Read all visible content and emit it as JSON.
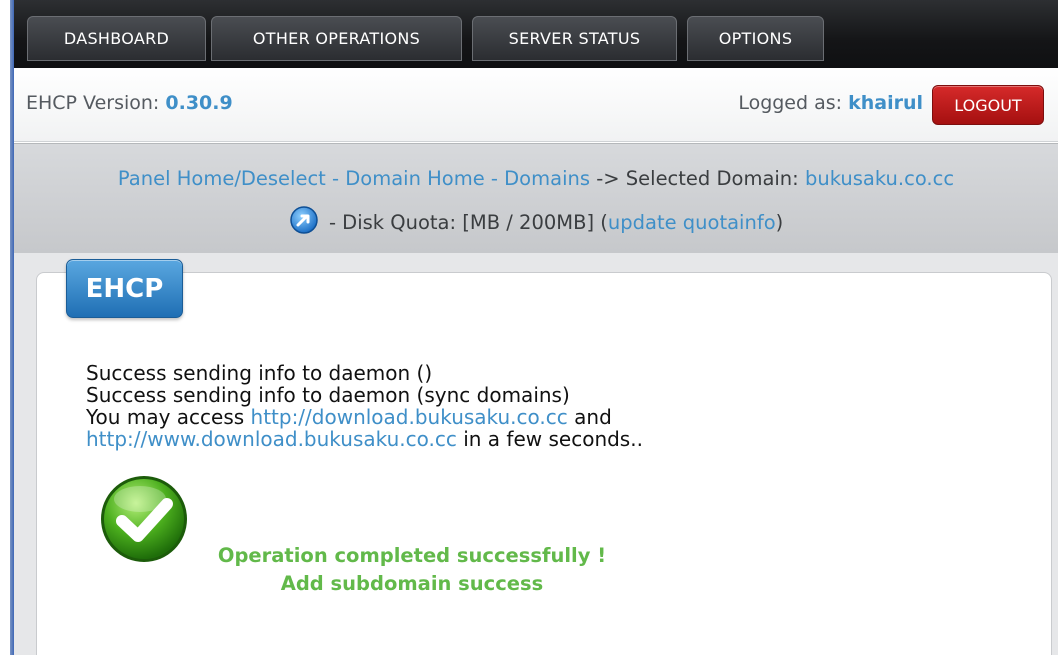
{
  "nav": {
    "items": [
      {
        "label": "DASHBOARD"
      },
      {
        "label": "OTHER OPERATIONS"
      },
      {
        "label": "SERVER STATUS"
      },
      {
        "label": "OPTIONS"
      }
    ]
  },
  "header": {
    "version_label": "EHCP Version:",
    "version_value": "0.30.9",
    "logged_label": "Logged as:",
    "logged_user": "khairul",
    "logout_label": "LOGOUT"
  },
  "breadcrumb": {
    "panel_home": "Panel Home/Deselect",
    "sep1": " - ",
    "domain_home": "Domain Home",
    "sep2": " - ",
    "domains": "Domains",
    "selected_label": " -> Selected Domain: ",
    "selected_domain": "bukusaku.co.cc",
    "disk_quota_text": " - Disk Quota: [MB / 200MB] (",
    "update_quota_link": "update quotainfo",
    "close_paren": ")"
  },
  "panel": {
    "tab_title": "EHCP",
    "lines": {
      "line1": "Success sending info to daemon ()",
      "line2": "Success sending info to daemon (sync domains)",
      "line3_prefix": "You may access ",
      "line3_link": "http://download.bukusaku.co.cc",
      "line3_suffix": " and",
      "line4_link": "http://www.download.bukusaku.co.cc",
      "line4_suffix": " in a few seconds.."
    },
    "success_title": "Operation completed successfully !",
    "success_detail": "Add subdomain success"
  },
  "colors": {
    "link": "#3f8fc8",
    "success_green": "#62b94a",
    "logout_red": "#c41a1a",
    "tab_blue": "#2f85c8"
  },
  "icons": {
    "quota_info": "info-arrow-icon",
    "success": "check-circle-icon"
  }
}
